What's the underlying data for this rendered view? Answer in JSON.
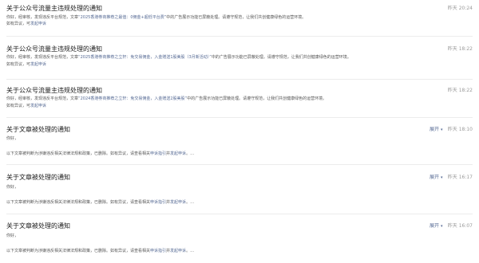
{
  "notices": [
    {
      "title": "关于公众号流量主违规处理的通知",
      "time": "昨天 20:24",
      "body_prefix": "你好，经审核，发现违反平台规范，文章",
      "body_highlight": "“2025香港券商推荐之最值：0佣金+超低平台费”",
      "body_suffix": "中的广告展示功能已屏蔽处理。请遵守规范，让我们共创健康绿色的运营环境。",
      "footer_prefix": "如有异议，可",
      "footer_link": "发起申诉"
    },
    {
      "title": "关于公众号流量主违规处理的通知",
      "time": "昨天 18:22",
      "body_prefix": "你好，经审核，发现违反平台规范，文章",
      "body_highlight": "“2025香港券商推荐之立轩：免交易佣金，入金赠送1股美股（3月新活动）”",
      "body_suffix": "中的广告展示功能已屏蔽处理。请遵守规范，让我们共创健康绿色的运营环境。",
      "footer_prefix": "如有异议，可",
      "footer_link": "发起申诉"
    },
    {
      "title": "关于公众号流量主违规处理的通知",
      "time": "昨天 18:22",
      "body_prefix": "你好，经审核，发现违反平台规范，文章",
      "body_highlight": "“2024香港券商推荐之立轩：免交易佣金，入金赠送2股美股”",
      "body_suffix": "中的广告展示功能已屏蔽处理。请遵守规范，让我们共创健康绿色的运营环境。",
      "footer_prefix": "如有异议，可",
      "footer_link": "发起申诉"
    }
  ],
  "articles": [
    {
      "title": "关于文章被处理的通知",
      "time": "昨天 18:10",
      "expand": "展开",
      "greeting": "你好，",
      "body_prefix": "以下文章被判断为涉嫌违反相关法律法规和政策，已删除。如有异议，请查看相关",
      "link_guide": "申诉指引",
      "body_mid": "并",
      "link_appeal": "发起申诉",
      "body_end": "。…"
    },
    {
      "title": "关于文章被处理的通知",
      "time": "昨天 16:17",
      "expand": "展开",
      "greeting": "你好，",
      "body_prefix": "以下文章被判断为涉嫌违反相关法律法规和政策，已删除。如有异议，请查看相关",
      "link_guide": "申诉指引",
      "body_mid": "并",
      "link_appeal": "发起申诉",
      "body_end": "。…"
    },
    {
      "title": "关于文章被处理的通知",
      "time": "昨天 16:07",
      "expand": "展开",
      "greeting": "你好，",
      "body_prefix": "以下文章被判断为涉嫌违反相关法律法规和政策，已删除。如有异议，请查看相关",
      "link_guide": "申诉指引",
      "body_mid": "并",
      "link_appeal": "发起申诉",
      "body_end": "。…"
    }
  ]
}
